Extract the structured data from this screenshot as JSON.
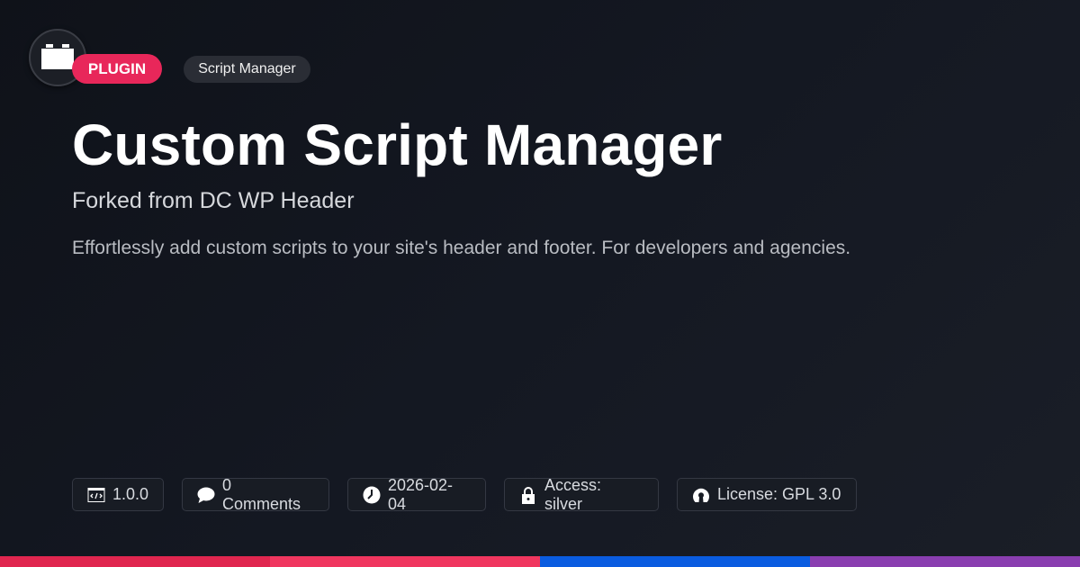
{
  "header": {
    "type_badge": "PLUGIN",
    "category_badge": "Script Manager"
  },
  "main": {
    "title": "Custom Script Manager",
    "subtitle": "Forked from DC WP Header",
    "description": "Effortlessly add custom scripts to your site's header and footer. For developers and agencies."
  },
  "meta": {
    "version": "1.0.0",
    "comments": "0 Comments",
    "date": "2026-02-04",
    "access": "Access: silver",
    "license": "License: GPL 3.0"
  },
  "icons": {
    "logo": "plugin-block-icon",
    "version": "code-icon",
    "comments": "comment-bubble-icon",
    "date": "clock-icon",
    "access": "lock-icon",
    "license": "open-source-icon"
  },
  "colors": {
    "accent": "#e8275a",
    "bar_segments": [
      "#e0264f",
      "#f0365f",
      "#0a5ce0",
      "#8a3eb0"
    ]
  }
}
